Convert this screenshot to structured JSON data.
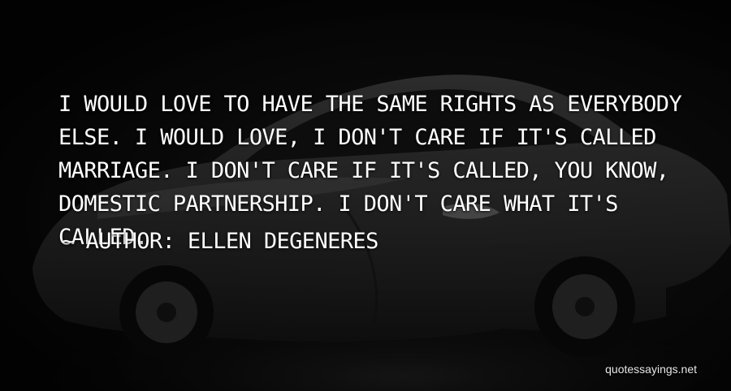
{
  "quote": {
    "text": "I would love to have the same rights as everybody else. I would love, I don't care if it's called marriage. I don't care if it's called, you know, domestic partnership. I don't care what it's called."
  },
  "author": {
    "prefix": "~",
    "label": "Author: Ellen DeGeneres"
  },
  "watermark": {
    "text": "quotessayings.net"
  },
  "background": {
    "subject": "white sports car, dimmed",
    "overlay_color": "#000000"
  }
}
